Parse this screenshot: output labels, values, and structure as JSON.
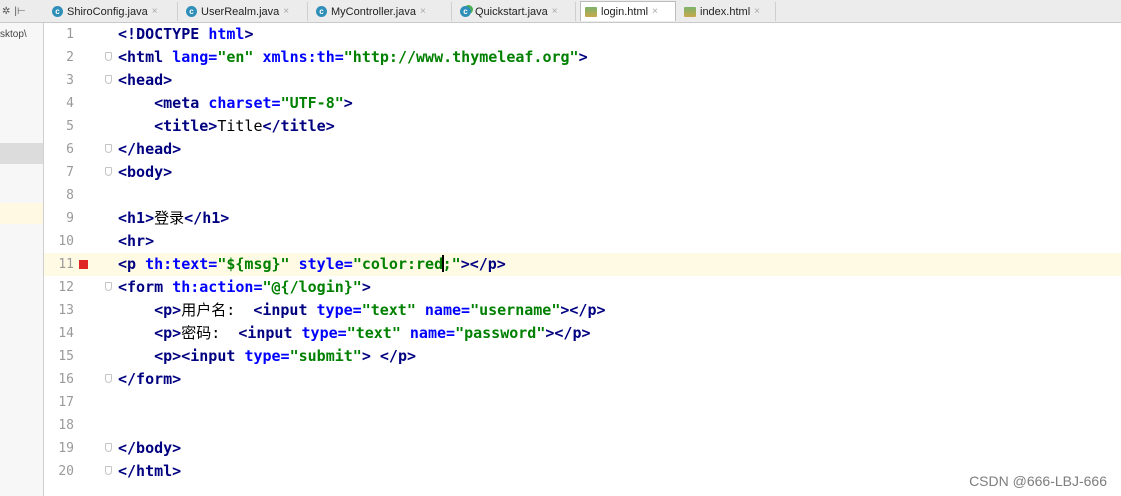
{
  "toolbar_glyphs": {
    "settings": "✲",
    "pin": "|⊢"
  },
  "tabs": [
    {
      "label": "ShiroConfig.java",
      "icon": "class-icon",
      "active": false
    },
    {
      "label": "UserRealm.java",
      "icon": "class-icon",
      "active": false
    },
    {
      "label": "MyController.java",
      "icon": "class-icon",
      "active": false
    },
    {
      "label": "Quickstart.java",
      "icon": "runnable-class-icon",
      "active": false
    },
    {
      "label": "login.html",
      "icon": "html-file-icon",
      "active": true
    },
    {
      "label": "index.html",
      "icon": "html-file-icon",
      "active": false
    }
  ],
  "tab_close_glyph": "×",
  "tab_class_glyph": "c",
  "project_label": "sktop\\",
  "lines": [
    {
      "n": "1",
      "tokens": [
        {
          "t": "<!"
        },
        {
          "t": "D"
        },
        {
          "t": "OCTYPE "
        },
        {
          "a": "html"
        },
        {
          "t": ">"
        }
      ]
    },
    {
      "n": "2",
      "tokens": [
        {
          "t": "<html "
        },
        {
          "a": "lang="
        },
        {
          "s": "\"en\""
        },
        {
          "x": " "
        },
        {
          "a": "xmlns:th="
        },
        {
          "s": "\"http://www.thymeleaf.org\""
        },
        {
          "t": ">"
        }
      ]
    },
    {
      "n": "3",
      "tokens": [
        {
          "t": "<head>"
        }
      ]
    },
    {
      "n": "4",
      "tokens": [
        {
          "x": "    "
        },
        {
          "t": "<meta "
        },
        {
          "a": "charset="
        },
        {
          "s": "\"UTF-8\""
        },
        {
          "t": ">"
        }
      ]
    },
    {
      "n": "5",
      "tokens": [
        {
          "x": "    "
        },
        {
          "t": "<title>"
        },
        {
          "x": "Title"
        },
        {
          "t": "</title>"
        }
      ]
    },
    {
      "n": "6",
      "tokens": [
        {
          "t": "</head>"
        }
      ]
    },
    {
      "n": "7",
      "tokens": [
        {
          "t": "<body>"
        }
      ]
    },
    {
      "n": "8",
      "tokens": []
    },
    {
      "n": "9",
      "tokens": [
        {
          "t": "<h1>"
        },
        {
          "x": "登录"
        },
        {
          "t": "</h1>"
        }
      ]
    },
    {
      "n": "10",
      "tokens": [
        {
          "t": "<hr>"
        }
      ]
    },
    {
      "n": "11",
      "tokens": [
        {
          "t": "<p "
        },
        {
          "a": "th:text="
        },
        {
          "s": "\"${msg}\""
        },
        {
          "x": " "
        },
        {
          "a": "style="
        },
        {
          "s": "\"color:red"
        },
        {
          "s": ";\""
        },
        {
          "t": "></p>"
        }
      ]
    },
    {
      "n": "12",
      "tokens": [
        {
          "t": "<form "
        },
        {
          "a": "th:action="
        },
        {
          "s": "\"@{/login}\""
        },
        {
          "t": ">"
        }
      ]
    },
    {
      "n": "13",
      "tokens": [
        {
          "x": "    "
        },
        {
          "t": "<p>"
        },
        {
          "x": "用户名:  "
        },
        {
          "t": "<input "
        },
        {
          "a": "type="
        },
        {
          "s": "\"text\""
        },
        {
          "x": " "
        },
        {
          "a": "name="
        },
        {
          "s": "\"username\""
        },
        {
          "t": "></p>"
        }
      ]
    },
    {
      "n": "14",
      "tokens": [
        {
          "x": "    "
        },
        {
          "t": "<p>"
        },
        {
          "x": "密码:  "
        },
        {
          "t": "<input "
        },
        {
          "a": "type="
        },
        {
          "s": "\"text\""
        },
        {
          "x": " "
        },
        {
          "a": "name="
        },
        {
          "s": "\"password\""
        },
        {
          "t": "></p>"
        }
      ]
    },
    {
      "n": "15",
      "tokens": [
        {
          "x": "    "
        },
        {
          "t": "<p><input "
        },
        {
          "a": "type="
        },
        {
          "s": "\"submit\""
        },
        {
          "t": "> </p>"
        }
      ]
    },
    {
      "n": "16",
      "tokens": [
        {
          "t": "</form>"
        }
      ]
    },
    {
      "n": "17",
      "tokens": []
    },
    {
      "n": "18",
      "tokens": []
    },
    {
      "n": "19",
      "tokens": [
        {
          "t": "</body>"
        }
      ]
    },
    {
      "n": "20",
      "tokens": [
        {
          "t": "</html>"
        }
      ]
    }
  ],
  "highlighted_line": "11",
  "breakpoint_line": "11",
  "fold_lines": [
    "2",
    "3",
    "6",
    "7",
    "12",
    "16",
    "19",
    "20"
  ],
  "watermark": "CSDN @666-LBJ-666",
  "colors": {
    "tag": "#000080",
    "attr": "#0000ff",
    "string": "#008000",
    "breakpoint": "#e02323",
    "line_highlight": "#fffae3"
  }
}
